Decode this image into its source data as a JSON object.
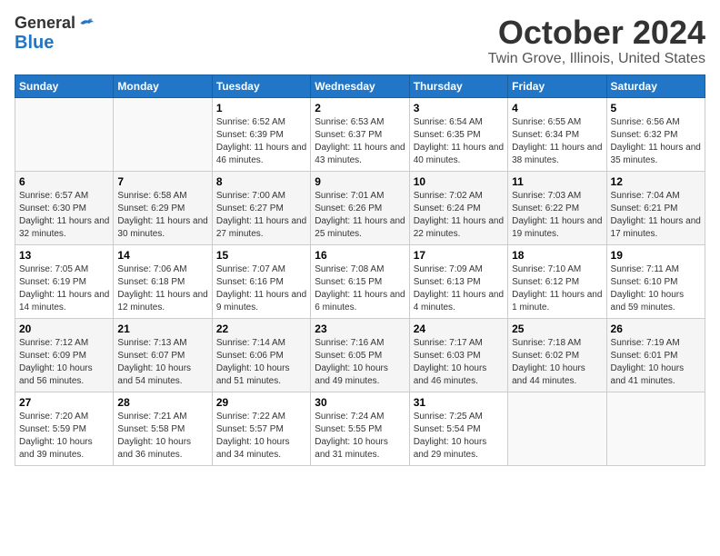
{
  "logo": {
    "line1": "General",
    "line2": "Blue"
  },
  "title": "October 2024",
  "location": "Twin Grove, Illinois, United States",
  "days_of_week": [
    "Sunday",
    "Monday",
    "Tuesday",
    "Wednesday",
    "Thursday",
    "Friday",
    "Saturday"
  ],
  "weeks": [
    [
      {
        "day": "",
        "info": ""
      },
      {
        "day": "",
        "info": ""
      },
      {
        "day": "1",
        "info": "Sunrise: 6:52 AM\nSunset: 6:39 PM\nDaylight: 11 hours and 46 minutes."
      },
      {
        "day": "2",
        "info": "Sunrise: 6:53 AM\nSunset: 6:37 PM\nDaylight: 11 hours and 43 minutes."
      },
      {
        "day": "3",
        "info": "Sunrise: 6:54 AM\nSunset: 6:35 PM\nDaylight: 11 hours and 40 minutes."
      },
      {
        "day": "4",
        "info": "Sunrise: 6:55 AM\nSunset: 6:34 PM\nDaylight: 11 hours and 38 minutes."
      },
      {
        "day": "5",
        "info": "Sunrise: 6:56 AM\nSunset: 6:32 PM\nDaylight: 11 hours and 35 minutes."
      }
    ],
    [
      {
        "day": "6",
        "info": "Sunrise: 6:57 AM\nSunset: 6:30 PM\nDaylight: 11 hours and 32 minutes."
      },
      {
        "day": "7",
        "info": "Sunrise: 6:58 AM\nSunset: 6:29 PM\nDaylight: 11 hours and 30 minutes."
      },
      {
        "day": "8",
        "info": "Sunrise: 7:00 AM\nSunset: 6:27 PM\nDaylight: 11 hours and 27 minutes."
      },
      {
        "day": "9",
        "info": "Sunrise: 7:01 AM\nSunset: 6:26 PM\nDaylight: 11 hours and 25 minutes."
      },
      {
        "day": "10",
        "info": "Sunrise: 7:02 AM\nSunset: 6:24 PM\nDaylight: 11 hours and 22 minutes."
      },
      {
        "day": "11",
        "info": "Sunrise: 7:03 AM\nSunset: 6:22 PM\nDaylight: 11 hours and 19 minutes."
      },
      {
        "day": "12",
        "info": "Sunrise: 7:04 AM\nSunset: 6:21 PM\nDaylight: 11 hours and 17 minutes."
      }
    ],
    [
      {
        "day": "13",
        "info": "Sunrise: 7:05 AM\nSunset: 6:19 PM\nDaylight: 11 hours and 14 minutes."
      },
      {
        "day": "14",
        "info": "Sunrise: 7:06 AM\nSunset: 6:18 PM\nDaylight: 11 hours and 12 minutes."
      },
      {
        "day": "15",
        "info": "Sunrise: 7:07 AM\nSunset: 6:16 PM\nDaylight: 11 hours and 9 minutes."
      },
      {
        "day": "16",
        "info": "Sunrise: 7:08 AM\nSunset: 6:15 PM\nDaylight: 11 hours and 6 minutes."
      },
      {
        "day": "17",
        "info": "Sunrise: 7:09 AM\nSunset: 6:13 PM\nDaylight: 11 hours and 4 minutes."
      },
      {
        "day": "18",
        "info": "Sunrise: 7:10 AM\nSunset: 6:12 PM\nDaylight: 11 hours and 1 minute."
      },
      {
        "day": "19",
        "info": "Sunrise: 7:11 AM\nSunset: 6:10 PM\nDaylight: 10 hours and 59 minutes."
      }
    ],
    [
      {
        "day": "20",
        "info": "Sunrise: 7:12 AM\nSunset: 6:09 PM\nDaylight: 10 hours and 56 minutes."
      },
      {
        "day": "21",
        "info": "Sunrise: 7:13 AM\nSunset: 6:07 PM\nDaylight: 10 hours and 54 minutes."
      },
      {
        "day": "22",
        "info": "Sunrise: 7:14 AM\nSunset: 6:06 PM\nDaylight: 10 hours and 51 minutes."
      },
      {
        "day": "23",
        "info": "Sunrise: 7:16 AM\nSunset: 6:05 PM\nDaylight: 10 hours and 49 minutes."
      },
      {
        "day": "24",
        "info": "Sunrise: 7:17 AM\nSunset: 6:03 PM\nDaylight: 10 hours and 46 minutes."
      },
      {
        "day": "25",
        "info": "Sunrise: 7:18 AM\nSunset: 6:02 PM\nDaylight: 10 hours and 44 minutes."
      },
      {
        "day": "26",
        "info": "Sunrise: 7:19 AM\nSunset: 6:01 PM\nDaylight: 10 hours and 41 minutes."
      }
    ],
    [
      {
        "day": "27",
        "info": "Sunrise: 7:20 AM\nSunset: 5:59 PM\nDaylight: 10 hours and 39 minutes."
      },
      {
        "day": "28",
        "info": "Sunrise: 7:21 AM\nSunset: 5:58 PM\nDaylight: 10 hours and 36 minutes."
      },
      {
        "day": "29",
        "info": "Sunrise: 7:22 AM\nSunset: 5:57 PM\nDaylight: 10 hours and 34 minutes."
      },
      {
        "day": "30",
        "info": "Sunrise: 7:24 AM\nSunset: 5:55 PM\nDaylight: 10 hours and 31 minutes."
      },
      {
        "day": "31",
        "info": "Sunrise: 7:25 AM\nSunset: 5:54 PM\nDaylight: 10 hours and 29 minutes."
      },
      {
        "day": "",
        "info": ""
      },
      {
        "day": "",
        "info": ""
      }
    ]
  ]
}
